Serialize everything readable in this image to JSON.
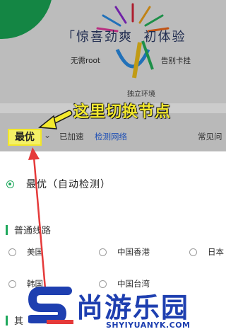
{
  "banner": {
    "title_left": "惊喜劲爽",
    "title_right": "初体验",
    "sub_left": "无需root",
    "sub_right": "告别卡挂",
    "sub_bottom": "独立环境"
  },
  "tabs": {
    "selected": "最优",
    "accelerated": "已加速",
    "detect": "检测网络",
    "faq": "常见问"
  },
  "annotation": {
    "callout": "这里切换节点"
  },
  "panel": {
    "best_option": "最优（自动检测）",
    "section_normal": "普通线路",
    "routes_row1": [
      "美国",
      "中国香港",
      "日本"
    ],
    "routes_row2": [
      "韩国",
      "中国台湾"
    ],
    "section_other": "其"
  },
  "watermark": {
    "text": "尚游乐园",
    "url": "SHYIYUANYK.COM"
  },
  "colors": {
    "accent_green": "#1fa85c",
    "callout_yellow": "#f3e92e",
    "link_blue": "#1e4fb5",
    "watermark_blue": "#1e3fb0"
  }
}
